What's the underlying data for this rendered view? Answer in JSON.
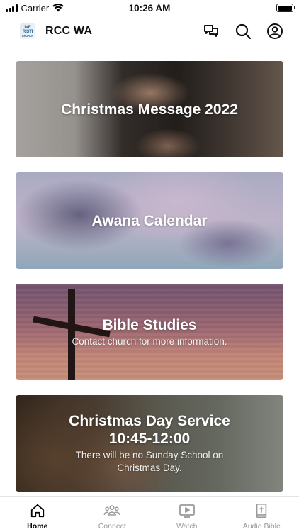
{
  "status_bar": {
    "carrier": "Carrier",
    "time": "10:26 AM",
    "battery_level": 1.0
  },
  "header": {
    "logo_lines": [
      "IVE",
      "RISTI",
      "CHURCH"
    ],
    "title": "RCC WA",
    "actions": [
      {
        "icon": "chat-icon"
      },
      {
        "icon": "search-icon"
      },
      {
        "icon": "account-icon"
      }
    ]
  },
  "cards": [
    {
      "title": "Christmas Message 2022",
      "subtitle": ""
    },
    {
      "title": "Awana Calendar",
      "subtitle": ""
    },
    {
      "title": "Bible Studies",
      "subtitle": "Contact church for more information."
    },
    {
      "title": "Christmas Day Service\n10:45-12:00",
      "subtitle": "There will be no Sunday School on Christmas Day."
    }
  ],
  "tab_bar": {
    "tabs": [
      {
        "label": "Home",
        "icon": "home-icon",
        "active": true
      },
      {
        "label": "Connect",
        "icon": "people-icon",
        "active": false
      },
      {
        "label": "Watch",
        "icon": "play-icon",
        "active": false
      },
      {
        "label": "Audio Bible",
        "icon": "bible-icon",
        "active": false
      }
    ]
  },
  "colors": {
    "active_tab": "#000000",
    "inactive_tab": "#9a9a9a",
    "logo_text": "#1f5f8f"
  }
}
